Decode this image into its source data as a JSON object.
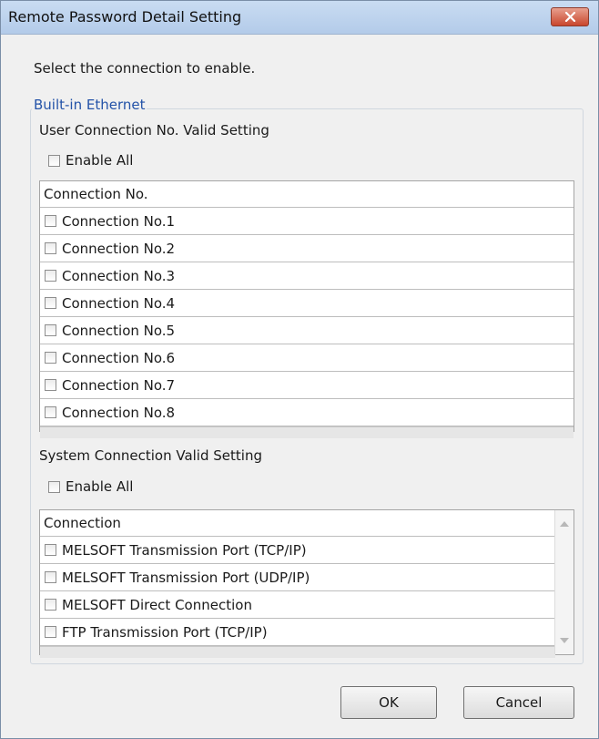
{
  "window": {
    "title": "Remote Password Detail Setting"
  },
  "prompt": "Select the connection to enable.",
  "group": {
    "legend": "Built-in Ethernet",
    "user_section": {
      "label": "User Connection No. Valid Setting",
      "enable_all": "Enable All",
      "column_header": "Connection No.",
      "rows": [
        "Connection No.1",
        "Connection No.2",
        "Connection No.3",
        "Connection No.4",
        "Connection No.5",
        "Connection No.6",
        "Connection No.7",
        "Connection No.8"
      ]
    },
    "system_section": {
      "label": "System Connection Valid Setting",
      "enable_all": "Enable All",
      "column_header": "Connection",
      "rows": [
        "MELSOFT Transmission Port (TCP/IP)",
        "MELSOFT Transmission Port (UDP/IP)",
        "MELSOFT Direct Connection",
        "FTP Transmission Port (TCP/IP)"
      ]
    }
  },
  "buttons": {
    "ok": "OK",
    "cancel": "Cancel"
  },
  "icons": {
    "close": "close-icon"
  },
  "colors": {
    "titlebar": "#b3cbe9",
    "close_button": "#c9462c",
    "group_legend": "#2453a8"
  }
}
